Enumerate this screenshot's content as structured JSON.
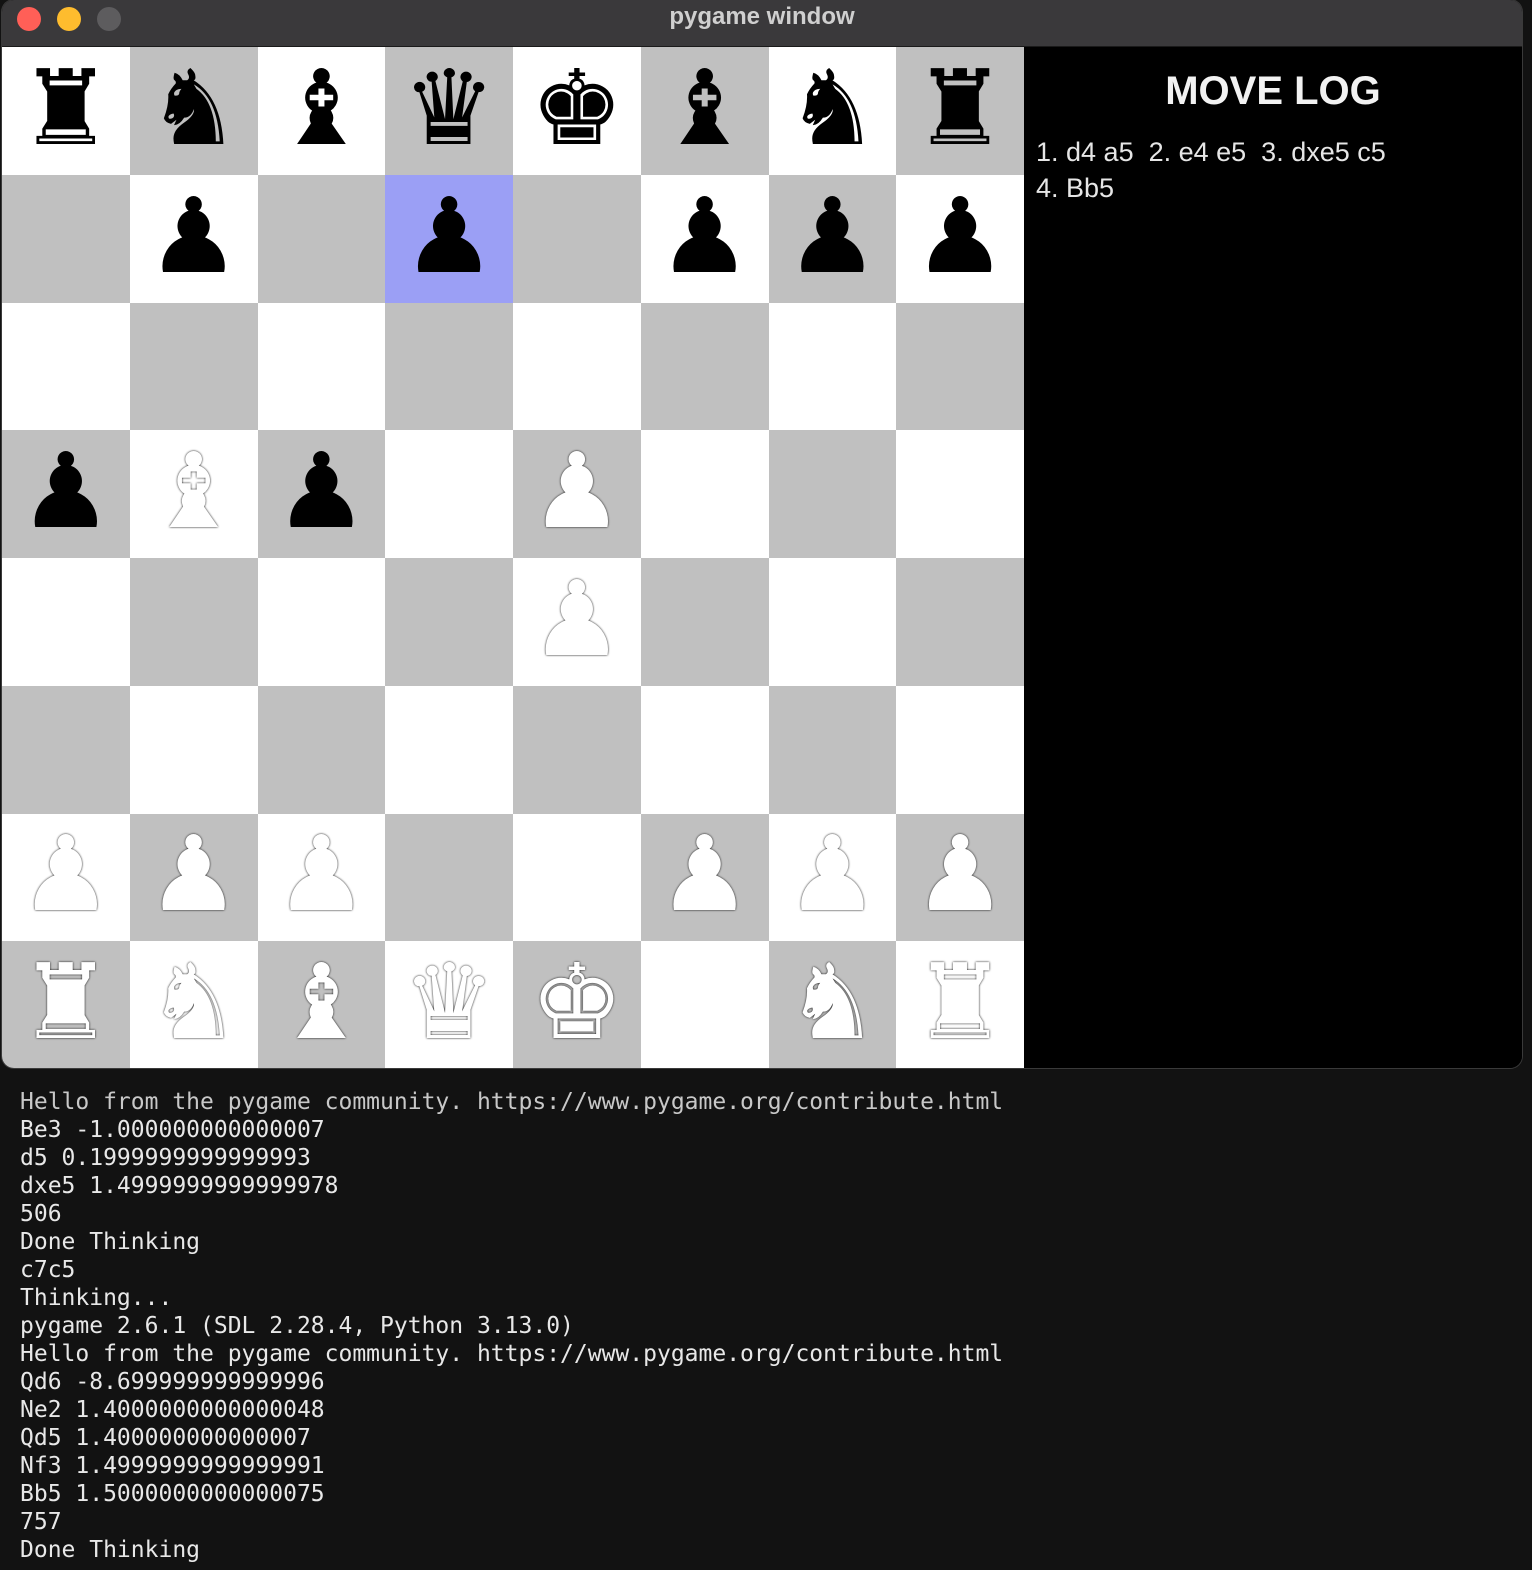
{
  "window": {
    "title": "pygame window"
  },
  "board": {
    "light_color": "#ffffff",
    "dark_color": "#c0c0c0",
    "highlight_color": "#9b9ff5",
    "highlight_square": "d7",
    "squares": [
      [
        "bR",
        "bN",
        "bB",
        "bQ",
        "bK",
        "bB",
        "bN",
        "bR"
      ],
      [
        "",
        "bP",
        "",
        "bP",
        "",
        "bP",
        "bP",
        "bP"
      ],
      [
        "",
        "",
        "",
        "",
        "",
        "",
        "",
        ""
      ],
      [
        "bP",
        "wB",
        "bP",
        "",
        "wP",
        "",
        "",
        ""
      ],
      [
        "",
        "",
        "",
        "",
        "wP",
        "",
        "",
        ""
      ],
      [
        "",
        "",
        "",
        "",
        "",
        "",
        "",
        ""
      ],
      [
        "wP",
        "wP",
        "wP",
        "",
        "",
        "wP",
        "wP",
        "wP"
      ],
      [
        "wR",
        "wN",
        "wB",
        "wQ",
        "wK",
        "",
        "wN",
        "wR"
      ]
    ]
  },
  "move_log": {
    "title": "MOVE LOG",
    "lines": [
      "1. d4 a5  2. e4 e5  3. dxe5 c5",
      "4. Bb5"
    ]
  },
  "terminal": {
    "lines": [
      "Hello from the pygame community. https://www.pygame.org/contribute.html",
      "Be3 -1.000000000000007",
      "d5 0.1999999999999993",
      "dxe5 1.4999999999999978",
      "506",
      "Done Thinking",
      "c7c5",
      "Thinking...",
      "pygame 2.6.1 (SDL 2.28.4, Python 3.13.0)",
      "Hello from the pygame community. https://www.pygame.org/contribute.html",
      "Qd6 -8.699999999999996",
      "Ne2 1.4000000000000048",
      "Qd5 1.400000000000007",
      "Nf3 1.4999999999999991",
      "Bb5 1.5000000000000075",
      "757",
      "Done Thinking"
    ]
  }
}
